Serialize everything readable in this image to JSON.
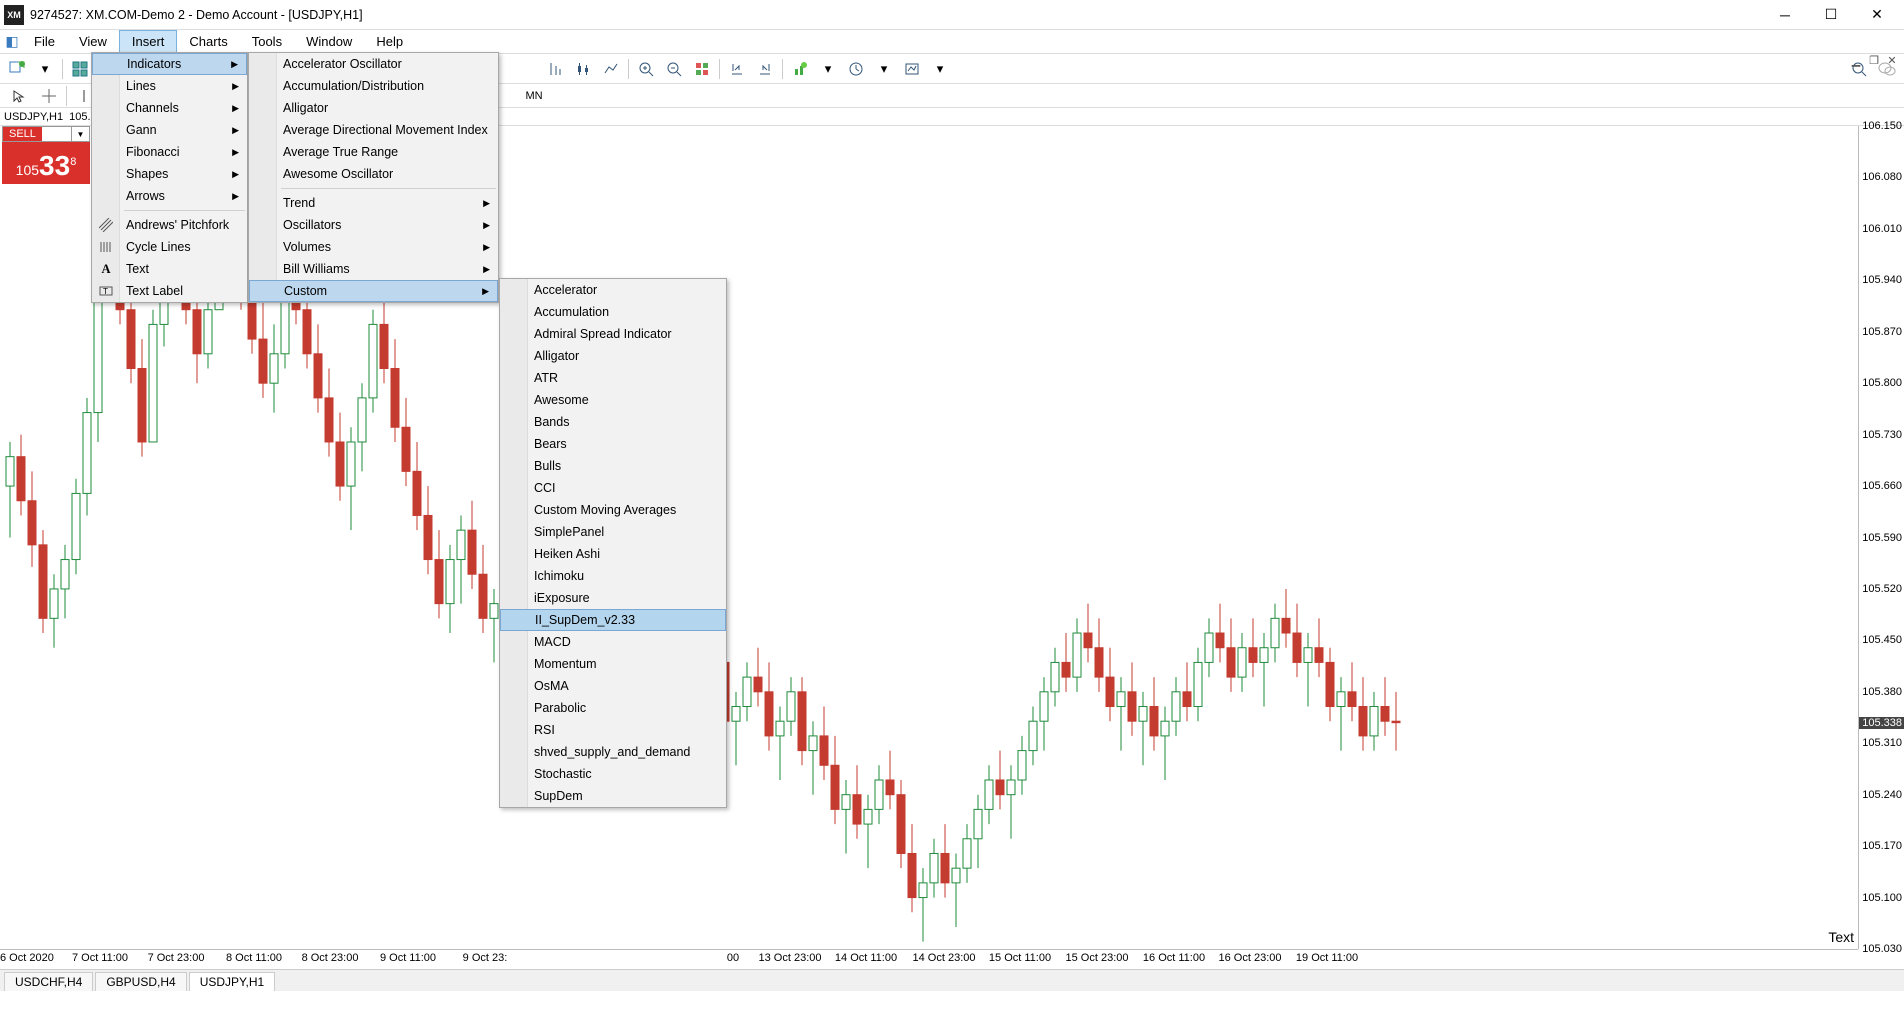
{
  "titlebar": {
    "title": "9274527: XM.COM-Demo 2 - Demo Account - [USDJPY,H1]",
    "app_abbrev": "XM"
  },
  "menubar": {
    "items": [
      "File",
      "View",
      "Insert",
      "Charts",
      "Tools",
      "Window",
      "Help"
    ],
    "active_index": 2
  },
  "timeframes": [
    "MN"
  ],
  "chart_header": {
    "symbol": "USDJPY,H1",
    "price": "105.3"
  },
  "sell": {
    "label": "SELL",
    "whole": "105",
    "big": "33",
    "frac": "8"
  },
  "tabs": {
    "items": [
      "USDCHF,H4",
      "GBPUSD,H4",
      "USDJPY,H1"
    ],
    "active_index": 2
  },
  "text_label": "Text",
  "price_axis": {
    "ticks": [
      "106.150",
      "106.080",
      "106.010",
      "105.940",
      "105.870",
      "105.800",
      "105.730",
      "105.660",
      "105.590",
      "105.520",
      "105.450",
      "105.380",
      "105.310",
      "105.240",
      "105.170",
      "105.100",
      "105.030"
    ],
    "current": "105.338"
  },
  "time_axis": {
    "ticks": [
      "6 Oct 2020",
      "7 Oct 11:00",
      "7 Oct 23:00",
      "8 Oct 11:00",
      "8 Oct 23:00",
      "9 Oct 11:00",
      "9 Oct 23:",
      "00",
      "13 Oct 23:00",
      "14 Oct 11:00",
      "14 Oct 23:00",
      "15 Oct 11:00",
      "15 Oct 23:00",
      "16 Oct 11:00",
      "16 Oct 23:00",
      "19 Oct 11:00"
    ]
  },
  "menu1": {
    "items": [
      {
        "label": "Indicators",
        "arrow": true,
        "highlight": true
      },
      {
        "label": "Lines",
        "arrow": true
      },
      {
        "label": "Channels",
        "arrow": true
      },
      {
        "label": "Gann",
        "arrow": true
      },
      {
        "label": "Fibonacci",
        "arrow": true
      },
      {
        "label": "Shapes",
        "arrow": true
      },
      {
        "label": "Arrows",
        "arrow": true
      },
      {
        "sep": true
      },
      {
        "label": "Andrews' Pitchfork",
        "icon": "pitchfork"
      },
      {
        "label": "Cycle Lines",
        "icon": "cycle"
      },
      {
        "label": "Text",
        "icon": "text"
      },
      {
        "label": "Text Label",
        "icon": "textlabel"
      }
    ]
  },
  "menu2": {
    "items": [
      {
        "label": "Accelerator Oscillator"
      },
      {
        "label": "Accumulation/Distribution"
      },
      {
        "label": "Alligator"
      },
      {
        "label": "Average Directional Movement Index"
      },
      {
        "label": "Average True Range"
      },
      {
        "label": "Awesome Oscillator"
      },
      {
        "sep": true
      },
      {
        "label": "Trend",
        "arrow": true
      },
      {
        "label": "Oscillators",
        "arrow": true
      },
      {
        "label": "Volumes",
        "arrow": true
      },
      {
        "label": "Bill Williams",
        "arrow": true
      },
      {
        "label": "Custom",
        "arrow": true,
        "highlight": true
      }
    ]
  },
  "menu3": {
    "items": [
      {
        "label": "Accelerator"
      },
      {
        "label": "Accumulation"
      },
      {
        "label": "Admiral Spread Indicator"
      },
      {
        "label": "Alligator"
      },
      {
        "label": "ATR"
      },
      {
        "label": "Awesome"
      },
      {
        "label": "Bands"
      },
      {
        "label": "Bears"
      },
      {
        "label": "Bulls"
      },
      {
        "label": "CCI"
      },
      {
        "label": "Custom Moving Averages"
      },
      {
        "label": "SimplePanel"
      },
      {
        "label": "Heiken Ashi"
      },
      {
        "label": "Ichimoku"
      },
      {
        "label": "iExposure"
      },
      {
        "label": "II_SupDem_v2.33",
        "highlight": true
      },
      {
        "label": "MACD"
      },
      {
        "label": "Momentum"
      },
      {
        "label": "OsMA"
      },
      {
        "label": "Parabolic"
      },
      {
        "label": "RSI"
      },
      {
        "label": "shved_supply_and_demand"
      },
      {
        "label": "Stochastic"
      },
      {
        "label": "SupDem"
      }
    ]
  },
  "chart_data": {
    "type": "candlestick",
    "symbol": "USDJPY",
    "timeframe": "H1",
    "ylim": [
      105.03,
      106.15
    ],
    "candles": [
      {
        "t": "6 Oct 2020",
        "o": 105.66,
        "h": 105.72,
        "l": 105.59,
        "c": 105.7
      },
      {
        "t": "",
        "o": 105.7,
        "h": 105.73,
        "l": 105.62,
        "c": 105.64
      },
      {
        "t": "",
        "o": 105.64,
        "h": 105.68,
        "l": 105.55,
        "c": 105.58
      },
      {
        "t": "",
        "o": 105.58,
        "h": 105.6,
        "l": 105.46,
        "c": 105.48
      },
      {
        "t": "",
        "o": 105.48,
        "h": 105.54,
        "l": 105.44,
        "c": 105.52
      },
      {
        "t": "",
        "o": 105.52,
        "h": 105.58,
        "l": 105.48,
        "c": 105.56
      },
      {
        "t": "",
        "o": 105.56,
        "h": 105.67,
        "l": 105.54,
        "c": 105.65
      },
      {
        "t": "",
        "o": 105.65,
        "h": 105.78,
        "l": 105.62,
        "c": 105.76
      },
      {
        "t": "7 Oct 11:00",
        "o": 105.76,
        "h": 106.0,
        "l": 105.72,
        "c": 105.98
      },
      {
        "t": "",
        "o": 105.98,
        "h": 106.08,
        "l": 105.92,
        "c": 105.95
      },
      {
        "t": "",
        "o": 105.95,
        "h": 106.02,
        "l": 105.88,
        "c": 105.9
      },
      {
        "t": "",
        "o": 105.9,
        "h": 105.94,
        "l": 105.8,
        "c": 105.82
      },
      {
        "t": "",
        "o": 105.82,
        "h": 105.86,
        "l": 105.7,
        "c": 105.72
      },
      {
        "t": "",
        "o": 105.72,
        "h": 105.9,
        "l": 105.74,
        "c": 105.88
      },
      {
        "t": "",
        "o": 105.88,
        "h": 106.05,
        "l": 105.85,
        "c": 106.02
      },
      {
        "t": "",
        "o": 106.02,
        "h": 106.1,
        "l": 105.95,
        "c": 105.98
      },
      {
        "t": "",
        "o": 105.98,
        "h": 106.04,
        "l": 105.88,
        "c": 105.9
      },
      {
        "t": "",
        "o": 105.9,
        "h": 105.98,
        "l": 105.8,
        "c": 105.84
      },
      {
        "t": "",
        "o": 105.84,
        "h": 105.92,
        "l": 105.82,
        "c": 105.9
      },
      {
        "t": "",
        "o": 105.9,
        "h": 106.11,
        "l": 105.96,
        "c": 106.08
      },
      {
        "t": "",
        "o": 106.08,
        "h": 106.1,
        "l": 105.98,
        "c": 106.0
      },
      {
        "t": "",
        "o": 106.0,
        "h": 106.04,
        "l": 105.9,
        "c": 105.92
      },
      {
        "t": "",
        "o": 105.92,
        "h": 105.96,
        "l": 105.84,
        "c": 105.86
      },
      {
        "t": "",
        "o": 105.86,
        "h": 105.94,
        "l": 105.78,
        "c": 105.8
      },
      {
        "t": "",
        "o": 105.8,
        "h": 105.88,
        "l": 105.76,
        "c": 105.84
      },
      {
        "t": "",
        "o": 105.84,
        "h": 105.98,
        "l": 105.82,
        "c": 105.96
      },
      {
        "t": "",
        "o": 105.96,
        "h": 106.02,
        "l": 105.88,
        "c": 105.9
      },
      {
        "t": "",
        "o": 105.9,
        "h": 105.94,
        "l": 105.82,
        "c": 105.84
      },
      {
        "t": "",
        "o": 105.84,
        "h": 105.88,
        "l": 105.76,
        "c": 105.78
      },
      {
        "t": "",
        "o": 105.78,
        "h": 105.82,
        "l": 105.7,
        "c": 105.72
      },
      {
        "t": "",
        "o": 105.72,
        "h": 105.76,
        "l": 105.64,
        "c": 105.66
      },
      {
        "t": "",
        "o": 105.66,
        "h": 105.74,
        "l": 105.6,
        "c": 105.72
      },
      {
        "t": "",
        "o": 105.72,
        "h": 105.8,
        "l": 105.68,
        "c": 105.78
      },
      {
        "t": "",
        "o": 105.78,
        "h": 105.9,
        "l": 105.76,
        "c": 105.88
      },
      {
        "t": "",
        "o": 105.88,
        "h": 105.92,
        "l": 105.8,
        "c": 105.82
      },
      {
        "t": "",
        "o": 105.82,
        "h": 105.86,
        "l": 105.72,
        "c": 105.74
      },
      {
        "t": "",
        "o": 105.74,
        "h": 105.78,
        "l": 105.66,
        "c": 105.68
      },
      {
        "t": "",
        "o": 105.68,
        "h": 105.72,
        "l": 105.6,
        "c": 105.62
      },
      {
        "t": "",
        "o": 105.62,
        "h": 105.66,
        "l": 105.54,
        "c": 105.56
      },
      {
        "t": "",
        "o": 105.56,
        "h": 105.6,
        "l": 105.48,
        "c": 105.5
      },
      {
        "t": "",
        "o": 105.5,
        "h": 105.58,
        "l": 105.46,
        "c": 105.56
      },
      {
        "t": "",
        "o": 105.56,
        "h": 105.62,
        "l": 105.5,
        "c": 105.6
      },
      {
        "t": "",
        "o": 105.6,
        "h": 105.64,
        "l": 105.52,
        "c": 105.54
      },
      {
        "t": "",
        "o": 105.54,
        "h": 105.58,
        "l": 105.46,
        "c": 105.48
      },
      {
        "t": "",
        "o": 105.48,
        "h": 105.52,
        "l": 105.42,
        "c": 105.5
      },
      {
        "t": "",
        "o": 105.5,
        "h": 105.54,
        "l": 105.44,
        "c": 105.46
      },
      {
        "t": "",
        "o": 105.46,
        "h": 105.52,
        "l": 105.4,
        "c": 105.5
      },
      {
        "t": "",
        "o": 105.5,
        "h": 105.56,
        "l": 105.48,
        "c": 105.54
      },
      {
        "t": "",
        "o": 105.54,
        "h": 105.58,
        "l": 105.5,
        "c": 105.52
      },
      {
        "t": "",
        "o": 105.52,
        "h": 105.56,
        "l": 105.46,
        "c": 105.48
      },
      {
        "t": "",
        "o": 105.48,
        "h": 105.54,
        "l": 105.44,
        "c": 105.52
      },
      {
        "t": "",
        "o": 105.52,
        "h": 105.58,
        "l": 105.48,
        "c": 105.56
      },
      {
        "t": "",
        "o": 105.56,
        "h": 105.6,
        "l": 105.5,
        "c": 105.52
      },
      {
        "t": "",
        "o": 105.52,
        "h": 105.56,
        "l": 105.46,
        "c": 105.48
      },
      {
        "t": "",
        "o": 105.48,
        "h": 105.5,
        "l": 105.38,
        "c": 105.4
      },
      {
        "t": "",
        "o": 105.4,
        "h": 105.44,
        "l": 105.34,
        "c": 105.42
      },
      {
        "t": "",
        "o": 105.42,
        "h": 105.48,
        "l": 105.4,
        "c": 105.46
      },
      {
        "t": "",
        "o": 105.46,
        "h": 105.52,
        "l": 105.42,
        "c": 105.5
      },
      {
        "t": "",
        "o": 105.5,
        "h": 105.54,
        "l": 105.44,
        "c": 105.46
      },
      {
        "t": "",
        "o": 105.46,
        "h": 105.5,
        "l": 105.4,
        "c": 105.48
      },
      {
        "t": "",
        "o": 105.48,
        "h": 105.52,
        "l": 105.42,
        "c": 105.44
      },
      {
        "t": "",
        "o": 105.44,
        "h": 105.48,
        "l": 105.36,
        "c": 105.38
      },
      {
        "t": "",
        "o": 105.38,
        "h": 105.42,
        "l": 105.32,
        "c": 105.4
      },
      {
        "t": "",
        "o": 105.4,
        "h": 105.46,
        "l": 105.38,
        "c": 105.44
      },
      {
        "t": "",
        "o": 105.44,
        "h": 105.48,
        "l": 105.4,
        "c": 105.42
      },
      {
        "t": "",
        "o": 105.42,
        "h": 105.44,
        "l": 105.32,
        "c": 105.34
      },
      {
        "t": "",
        "o": 105.34,
        "h": 105.38,
        "l": 105.28,
        "c": 105.36
      },
      {
        "t": "",
        "o": 105.36,
        "h": 105.42,
        "l": 105.34,
        "c": 105.4
      },
      {
        "t": "",
        "o": 105.4,
        "h": 105.44,
        "l": 105.36,
        "c": 105.38
      },
      {
        "t": "",
        "o": 105.38,
        "h": 105.42,
        "l": 105.3,
        "c": 105.32
      },
      {
        "t": "",
        "o": 105.32,
        "h": 105.36,
        "l": 105.26,
        "c": 105.34
      },
      {
        "t": "",
        "o": 105.34,
        "h": 105.4,
        "l": 105.32,
        "c": 105.38
      },
      {
        "t": "",
        "o": 105.38,
        "h": 105.4,
        "l": 105.28,
        "c": 105.3
      },
      {
        "t": "",
        "o": 105.3,
        "h": 105.34,
        "l": 105.24,
        "c": 105.32
      },
      {
        "t": "",
        "o": 105.32,
        "h": 105.36,
        "l": 105.26,
        "c": 105.28
      },
      {
        "t": "",
        "o": 105.28,
        "h": 105.32,
        "l": 105.2,
        "c": 105.22
      },
      {
        "t": "",
        "o": 105.22,
        "h": 105.26,
        "l": 105.16,
        "c": 105.24
      },
      {
        "t": "",
        "o": 105.24,
        "h": 105.28,
        "l": 105.18,
        "c": 105.2
      },
      {
        "t": "",
        "o": 105.2,
        "h": 105.24,
        "l": 105.14,
        "c": 105.22
      },
      {
        "t": "",
        "o": 105.22,
        "h": 105.28,
        "l": 105.2,
        "c": 105.26
      },
      {
        "t": "",
        "o": 105.26,
        "h": 105.3,
        "l": 105.22,
        "c": 105.24
      },
      {
        "t": "",
        "o": 105.24,
        "h": 105.26,
        "l": 105.14,
        "c": 105.16
      },
      {
        "t": "",
        "o": 105.16,
        "h": 105.2,
        "l": 105.08,
        "c": 105.1
      },
      {
        "t": "",
        "o": 105.1,
        "h": 105.14,
        "l": 105.04,
        "c": 105.12
      },
      {
        "t": "",
        "o": 105.12,
        "h": 105.18,
        "l": 105.1,
        "c": 105.16
      },
      {
        "t": "",
        "o": 105.16,
        "h": 105.2,
        "l": 105.1,
        "c": 105.12
      },
      {
        "t": "",
        "o": 105.12,
        "h": 105.16,
        "l": 105.06,
        "c": 105.14
      },
      {
        "t": "",
        "o": 105.14,
        "h": 105.2,
        "l": 105.12,
        "c": 105.18
      },
      {
        "t": "",
        "o": 105.18,
        "h": 105.24,
        "l": 105.14,
        "c": 105.22
      },
      {
        "t": "",
        "o": 105.22,
        "h": 105.28,
        "l": 105.2,
        "c": 105.26
      },
      {
        "t": "",
        "o": 105.26,
        "h": 105.3,
        "l": 105.22,
        "c": 105.24
      },
      {
        "t": "",
        "o": 105.24,
        "h": 105.28,
        "l": 105.18,
        "c": 105.26
      },
      {
        "t": "",
        "o": 105.26,
        "h": 105.32,
        "l": 105.24,
        "c": 105.3
      },
      {
        "t": "",
        "o": 105.3,
        "h": 105.36,
        "l": 105.28,
        "c": 105.34
      },
      {
        "t": "",
        "o": 105.34,
        "h": 105.4,
        "l": 105.3,
        "c": 105.38
      },
      {
        "t": "",
        "o": 105.38,
        "h": 105.44,
        "l": 105.36,
        "c": 105.42
      },
      {
        "t": "",
        "o": 105.42,
        "h": 105.46,
        "l": 105.38,
        "c": 105.4
      },
      {
        "t": "",
        "o": 105.4,
        "h": 105.48,
        "l": 105.38,
        "c": 105.46
      },
      {
        "t": "",
        "o": 105.46,
        "h": 105.5,
        "l": 105.42,
        "c": 105.44
      },
      {
        "t": "",
        "o": 105.44,
        "h": 105.48,
        "l": 105.38,
        "c": 105.4
      },
      {
        "t": "",
        "o": 105.4,
        "h": 105.44,
        "l": 105.34,
        "c": 105.36
      },
      {
        "t": "",
        "o": 105.36,
        "h": 105.4,
        "l": 105.3,
        "c": 105.38
      },
      {
        "t": "",
        "o": 105.38,
        "h": 105.42,
        "l": 105.32,
        "c": 105.34
      },
      {
        "t": "",
        "o": 105.34,
        "h": 105.38,
        "l": 105.28,
        "c": 105.36
      },
      {
        "t": "",
        "o": 105.36,
        "h": 105.4,
        "l": 105.3,
        "c": 105.32
      },
      {
        "t": "",
        "o": 105.32,
        "h": 105.36,
        "l": 105.26,
        "c": 105.34
      },
      {
        "t": "",
        "o": 105.34,
        "h": 105.4,
        "l": 105.32,
        "c": 105.38
      },
      {
        "t": "",
        "o": 105.38,
        "h": 105.42,
        "l": 105.34,
        "c": 105.36
      },
      {
        "t": "",
        "o": 105.36,
        "h": 105.44,
        "l": 105.34,
        "c": 105.42
      },
      {
        "t": "",
        "o": 105.42,
        "h": 105.48,
        "l": 105.4,
        "c": 105.46
      },
      {
        "t": "",
        "o": 105.46,
        "h": 105.5,
        "l": 105.42,
        "c": 105.44
      },
      {
        "t": "",
        "o": 105.44,
        "h": 105.48,
        "l": 105.38,
        "c": 105.4
      },
      {
        "t": "",
        "o": 105.4,
        "h": 105.46,
        "l": 105.38,
        "c": 105.44
      },
      {
        "t": "",
        "o": 105.44,
        "h": 105.48,
        "l": 105.4,
        "c": 105.42
      },
      {
        "t": "",
        "o": 105.42,
        "h": 105.46,
        "l": 105.36,
        "c": 105.44
      },
      {
        "t": "",
        "o": 105.44,
        "h": 105.5,
        "l": 105.42,
        "c": 105.48
      },
      {
        "t": "",
        "o": 105.48,
        "h": 105.52,
        "l": 105.44,
        "c": 105.46
      },
      {
        "t": "",
        "o": 105.46,
        "h": 105.5,
        "l": 105.4,
        "c": 105.42
      },
      {
        "t": "",
        "o": 105.42,
        "h": 105.46,
        "l": 105.36,
        "c": 105.44
      },
      {
        "t": "",
        "o": 105.44,
        "h": 105.48,
        "l": 105.4,
        "c": 105.42
      },
      {
        "t": "",
        "o": 105.42,
        "h": 105.44,
        "l": 105.34,
        "c": 105.36
      },
      {
        "t": "",
        "o": 105.36,
        "h": 105.4,
        "l": 105.3,
        "c": 105.38
      },
      {
        "t": "",
        "o": 105.38,
        "h": 105.42,
        "l": 105.34,
        "c": 105.36
      },
      {
        "t": "",
        "o": 105.36,
        "h": 105.4,
        "l": 105.3,
        "c": 105.32
      },
      {
        "t": "",
        "o": 105.32,
        "h": 105.38,
        "l": 105.3,
        "c": 105.36
      },
      {
        "t": "",
        "o": 105.36,
        "h": 105.4,
        "l": 105.32,
        "c": 105.34
      },
      {
        "t": "19 Oct 11:00",
        "o": 105.34,
        "h": 105.38,
        "l": 105.3,
        "c": 105.338
      }
    ]
  }
}
